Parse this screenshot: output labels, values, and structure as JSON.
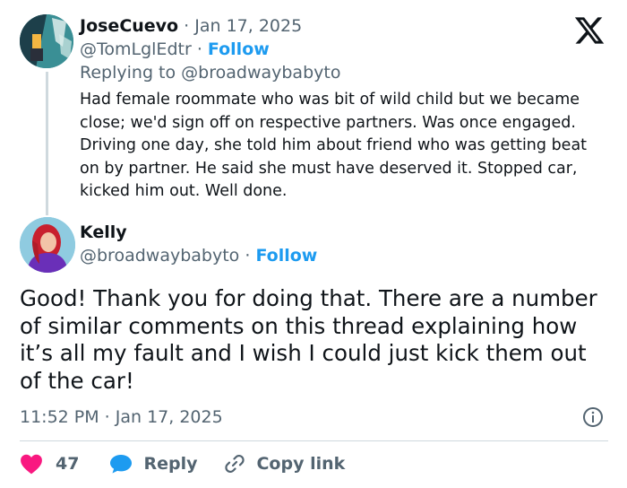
{
  "icons": {
    "brand": "x-logo-icon",
    "info": "info-icon",
    "like": "heart-icon",
    "reply": "speech-bubble-icon",
    "copy": "link-icon"
  },
  "colors": {
    "accent": "#1d9bf0",
    "like": "#f91880",
    "text": "#0f1419",
    "muted": "#536471",
    "line": "#cfd9de"
  },
  "parent_tweet": {
    "name": "JoseCuevo",
    "date": "· Jan 17, 2025",
    "handle": "@TomLglEdtr",
    "separator": "·",
    "follow": "Follow",
    "replying_to": "Replying to @broadwaybabyto",
    "text": "Had female roommate who was bit of wild child but we became close;  we'd sign off on respective partners. Was once engaged. Driving one day, she told him about friend who was getting beat on by partner. He said she must have deserved it. Stopped car,  kicked him out. Well done."
  },
  "main_tweet": {
    "name": "Kelly",
    "handle": "@broadwaybabyto",
    "separator": "·",
    "follow": "Follow",
    "text": "Good! Thank you for doing that. There are a number of similar comments on this thread explaining how it’s all my fault and I wish I could just kick them out of the car!",
    "timestamp": "11:52 PM · Jan 17, 2025"
  },
  "actions": {
    "like_count": "47",
    "reply_label": "Reply",
    "copy_label": "Copy link"
  }
}
